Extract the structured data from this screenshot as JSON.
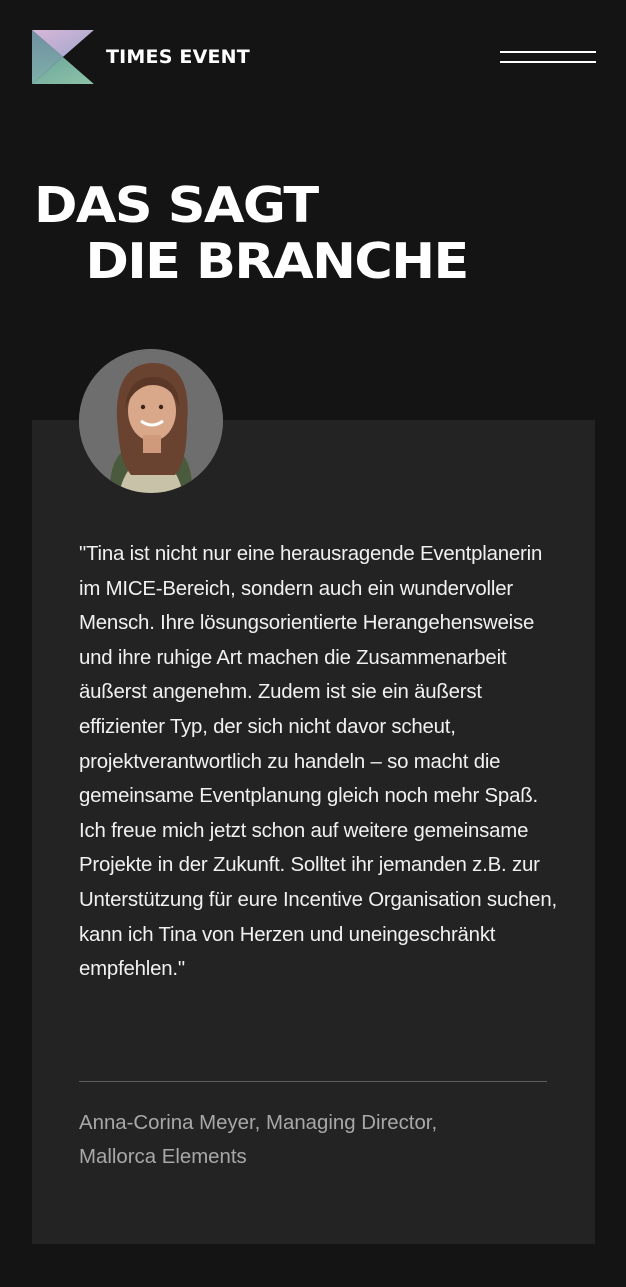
{
  "header": {
    "brand_name": "TIMES EVENT",
    "menu_icon": "hamburger-menu-icon"
  },
  "title": {
    "line1": "DAS SAGT",
    "line2": "DIE BRANCHE"
  },
  "testimonial": {
    "quote": "\"Tina ist nicht nur eine herausragende Eventplanerin im MICE-Bereich, sondern auch ein wundervoller Mensch. Ihre lösungsorientierte Herangehensweise und ihre ruhige Art machen die Zusammenarbeit äußerst angenehm. Zudem ist sie ein äußerst effizienter Typ, der sich nicht davor scheut, projektverantwortlich zu handeln – so macht die gemeinsame Eventplanung gleich noch mehr Spaß. Ich freue mich jetzt schon auf weitere gemeinsame Projekte in der Zukunft. Solltet ihr jemanden z.B. zur Unterstützung für eure Incentive Organisation suchen, kann ich Tina von Herzen und uneingeschränkt empfehlen.\"",
    "author_line1": "Anna-Corina Meyer, Managing Director,",
    "author_line2": "Mallorca Elements"
  },
  "colors": {
    "background": "#141414",
    "card": "#232323",
    "text": "#f1f1f1",
    "muted": "#a8a8a8"
  }
}
